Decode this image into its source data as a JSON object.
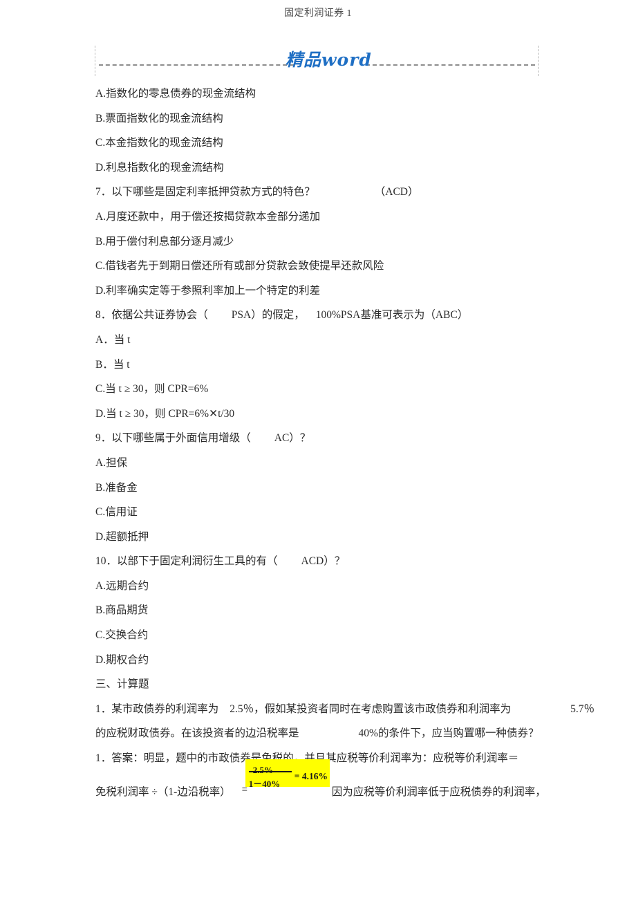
{
  "header": {
    "running_title": "固定利润证券 1"
  },
  "banner": {
    "watermark_text": "精品word",
    "accent_color": "#1f6fc4",
    "rule_color": "#7a7a7a"
  },
  "content": {
    "q6_options": [
      "A.指数化的零息债券的现金流结构",
      "B.票面指数化的现金流结构",
      "C.本金指数化的现金流结构",
      "D.利息指数化的现金流结构"
    ],
    "q7": {
      "stem": "7．以下哪些是固定利率抵押贷款方式的特色？",
      "answer": "（ACD）",
      "options": [
        "A.月度还款中，用于偿还按揭贷款本金部分递加",
        "B.用于偿付利息部分逐月减少",
        "C.借钱者先于到期日偿还所有或部分贷款会致使提早还款风险",
        "D.利率确实定等于参照利率加上一个特定的利差"
      ]
    },
    "q8": {
      "stem_part1": "8．依据公共证券协会（",
      "stem_psa": "PSA",
      "stem_part2": "）的假定，",
      "stem_part3": "100%PSA",
      "stem_part4": "基准可表示为（",
      "answer": "ABC）",
      "options": [
        "A．当 t",
        "B．当 t",
        "C.当 t ≥ 30，则 CPR=6%",
        "D.当 t ≥ 30，则 CPR=6%✕t/30"
      ]
    },
    "q9": {
      "stem_part1": "9．以下哪些属于外面信用增级（",
      "answer": "AC）？",
      "options": [
        "A.担保",
        "B.准备金",
        "C.信用证",
        "D.超额抵押"
      ]
    },
    "q10": {
      "stem_part1": "10．以部下于固定利润衍生工具的有（",
      "answer": "ACD）？",
      "options": [
        "A.远期合约",
        "B.商品期货",
        "C.交换合约",
        "D.期权合约"
      ]
    },
    "section3_title": "三、计算题",
    "calc1": {
      "line1_a": "1．某市政债券的利润率为",
      "line1_rate1": "2.5％",
      "line1_b": "，假如某投资者同时在考虑购置该市政债券和利润率为",
      "line1_rate2": "5.7％",
      "line2_a": "的应税财政债券。在该投资者的边沿税率是",
      "line2_rate": "40%",
      "line2_b": "的条件下，应当购置哪一种债券？"
    },
    "answer1": {
      "line1": "1．答案：明显，题中的市政债券是免税的，并且其应税等价利润率为：应税等价利润率＝",
      "line2_a": "免税利润率 ÷（1-边沿税率）",
      "line2_eq": "=",
      "line2_b": "因为应税等价利润率低于应税债券的利润率，",
      "formula": {
        "numerator": "2.5%",
        "denominator": "1－40%",
        "result": "= 4.16%",
        "highlight_color": "#ffff00"
      }
    }
  }
}
